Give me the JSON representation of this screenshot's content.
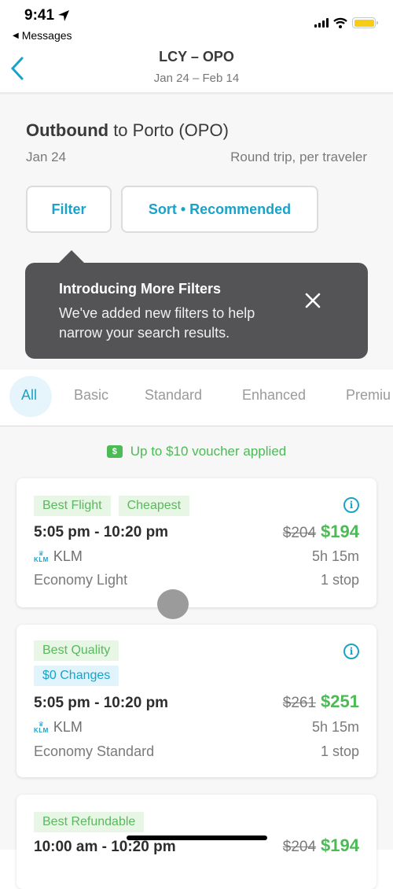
{
  "status_bar": {
    "time": "9:41",
    "back_label": "Messages",
    "battery_color": "#f5cd17"
  },
  "nav": {
    "title": "LCY – OPO",
    "subtitle": "Jan 24 – Feb 14"
  },
  "summary": {
    "title_bold": "Outbound",
    "title_rest": " to Porto (OPO)",
    "date": "Jan 24",
    "trip_type": "Round trip, per traveler",
    "filter_label": "Filter",
    "sort_label": "Sort • Recommended"
  },
  "tooltip": {
    "title": "Introducing More Filters",
    "body": "We've added new filters to help narrow your search results."
  },
  "tabs": [
    {
      "label": "All",
      "active": true
    },
    {
      "label": "Basic",
      "active": false
    },
    {
      "label": "Standard",
      "active": false
    },
    {
      "label": "Enhanced",
      "active": false
    },
    {
      "label": "Premiu",
      "active": false
    }
  ],
  "voucher": {
    "icon_glyph": "$",
    "text": "Up to $10 voucher applied"
  },
  "flights": [
    {
      "badges": [
        {
          "label": "Best Flight",
          "tone": "green"
        },
        {
          "label": "Cheapest",
          "tone": "green"
        }
      ],
      "times": "5:05 pm - 10:20 pm",
      "old_price": "$204",
      "price": "$194",
      "airline": "KLM",
      "duration": "5h 15m",
      "fare": "Economy Light",
      "stops": "1 stop"
    },
    {
      "badges": [
        {
          "label": "Best Quality",
          "tone": "green"
        },
        {
          "label": "$0 Changes",
          "tone": "blue"
        }
      ],
      "times": "5:05 pm - 10:20 pm",
      "old_price": "$261",
      "price": "$251",
      "airline": "KLM",
      "duration": "5h 15m",
      "fare": "Economy Standard",
      "stops": "1 stop"
    },
    {
      "badges": [
        {
          "label": "Best Refundable",
          "tone": "green"
        }
      ],
      "times": "10:00 am - 10:20 pm",
      "old_price": "$204",
      "price": "$194"
    }
  ],
  "klm_logo_text": "KLM",
  "colors": {
    "accent": "#1aa3c8",
    "price_green": "#4cba55",
    "tooltip_bg": "#545355"
  }
}
